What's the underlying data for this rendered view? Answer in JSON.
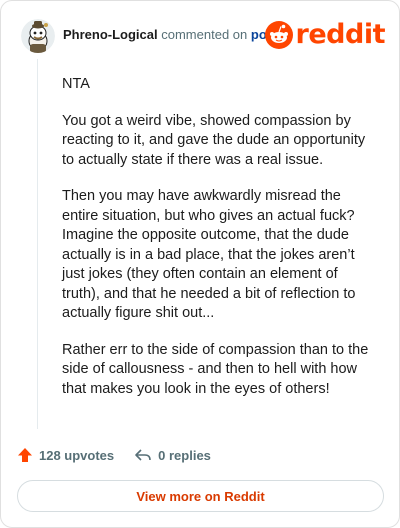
{
  "comment": {
    "author": "Phreno-Logical",
    "action_text": "commented on",
    "post_link": "post",
    "paragraphs": [
      "NTA",
      "You got a weird vibe, showed compassion by reacting to it, and gave the dude an opportunity to actually state if there was a real issue.",
      "Then you may have awkwardly misread the entire situation, but who gives an actual fuck? Imagine the opposite outcome, that the dude actually is in a bad place, that the jokes aren’t just jokes (they often contain an element of truth), and that he needed a bit of reflection to actually figure shit out...",
      "Rather err to the side of compassion than to the side of callousness - and then to hell with how that makes you look in the eyes of others!"
    ],
    "upvotes": "128 upvotes",
    "replies": "0 replies"
  },
  "brand": {
    "wordmark": "reddit",
    "color": "#ff4500"
  },
  "actions": {
    "view_more": "View more on Reddit"
  },
  "icons": {
    "avatar": "avatar-icon",
    "logo": "reddit-snoo-icon",
    "upvote": "upvote-arrow-icon",
    "reply": "reply-arrow-icon"
  }
}
